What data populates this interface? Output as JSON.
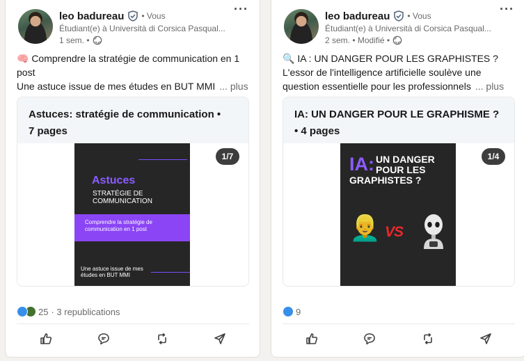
{
  "posts": [
    {
      "author": {
        "name": "leo badureau",
        "you_label": "• Vous",
        "headline": "Étudiant(e) à Università di Corsica Pasqual...",
        "meta": "1 sem. •"
      },
      "text": {
        "line1": "🧠 Comprendre la stratégie de communication en 1",
        "line2": "post",
        "line3": "Une astuce issue de mes études en BUT MMI",
        "see_more": "... plus"
      },
      "document": {
        "title_line1": "Astuces: stratégie de communication •",
        "title_line2": "7 pages",
        "page_badge": "1/7",
        "slide": {
          "title": "Astuces",
          "subtitle": "STRATÉGIE DE COMMUNICATION",
          "band_text": "Comprendre la stratégie de communication en 1 post",
          "footer": "Une astuce issue de mes études en BUT MMI"
        }
      },
      "social": {
        "count": "25",
        "reposts": "· 3 republications"
      }
    },
    {
      "author": {
        "name": "leo badureau",
        "you_label": "• Vous",
        "headline": "Étudiant(e) à Università di Corsica Pasqual...",
        "meta": "2 sem. • Modifié •"
      },
      "text": {
        "line1": "🔍 IA : UN DANGER POUR LES GRAPHISTES ?",
        "line2": "L'essor de l'intelligence artificielle soulève une",
        "line3": "question essentielle pour les professionnels",
        "see_more": "... plus"
      },
      "document": {
        "title_line1": "IA: UN DANGER POUR LE GRAPHISME ?",
        "title_line2": "• 4 pages",
        "page_badge": "1/4",
        "slide": {
          "big": "IA:",
          "title": "UN DANGER POUR LES GRAPHISTES ?",
          "vs": "VS",
          "person_emoji": "👱‍♂️"
        }
      },
      "social": {
        "count": "9",
        "reposts": ""
      }
    }
  ],
  "icons": {
    "verified": "shield-check-icon",
    "globe": "globe-icon",
    "more": "more-horizontal-icon",
    "like": "thumbs-up-icon",
    "comment": "comment-icon",
    "repost": "repost-icon",
    "send": "send-icon"
  },
  "colors": {
    "accent_purple": "#8b5cff",
    "like_blue": "#378fe9",
    "celebrate_green": "#44712e",
    "vs_red": "#e8292b"
  },
  "more_glyph": "···"
}
